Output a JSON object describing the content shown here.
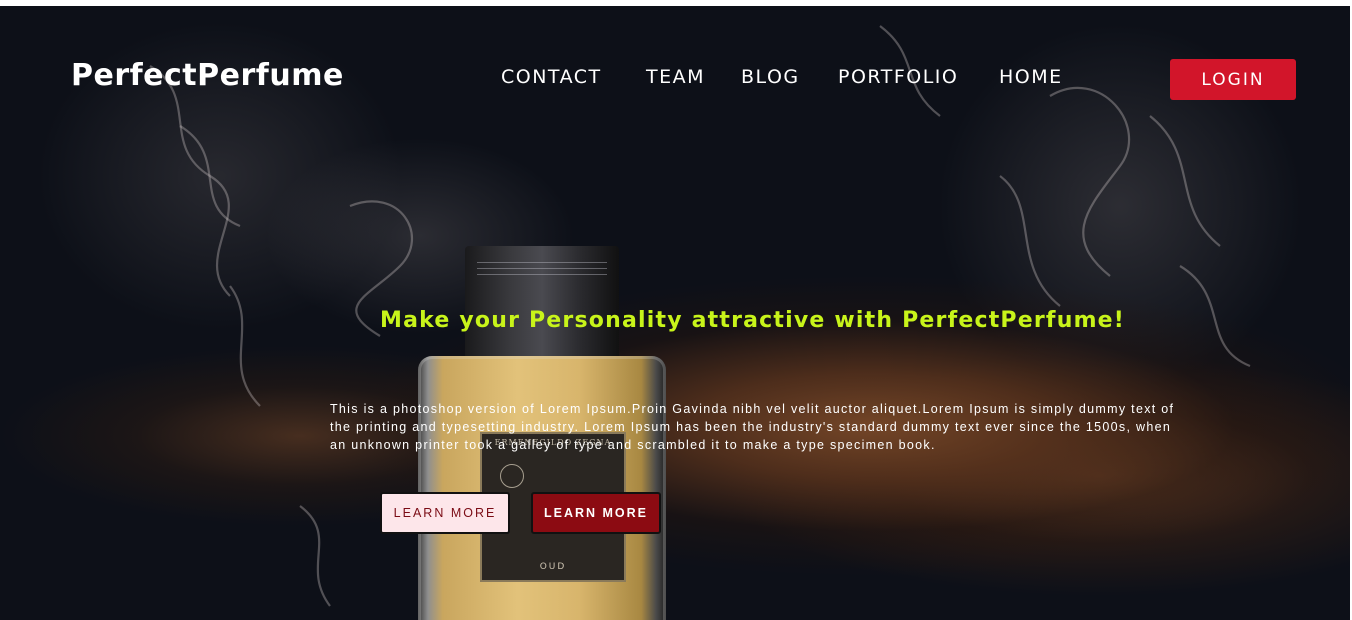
{
  "brand": {
    "name": "PerfectPerfume"
  },
  "nav": {
    "items": [
      {
        "label": "CONTACT"
      },
      {
        "label": "TEAM"
      },
      {
        "label": "BLOG"
      },
      {
        "label": "PORTFOLIO"
      },
      {
        "label": "HOME"
      }
    ],
    "login_label": "LOGIN"
  },
  "hero": {
    "headline": "Make your Personality attractive with PerfectPerfume!",
    "body": "This is a photoshop version of Lorem Ipsum.Proin Gavinda nibh vel velit auctor aliquet.Lorem Ipsum is simply dummy text of the printing and typesetting industry. Lorem Ipsum has been the industry's standard dummy text ever since the 1500s, when an unknown printer took a galley of type and scrambled it to make a type specimen book.",
    "buttons": [
      {
        "label": "LEARN MORE",
        "style": "light"
      },
      {
        "label": "LEARN MORE",
        "style": "dark"
      }
    ],
    "bottle_label": {
      "brand": "ERMENEGILDO ZEGNA",
      "name": "OUD"
    }
  },
  "colors": {
    "background": "#0d1018",
    "accent_headline": "#c8f41a",
    "login_button": "#d2152a",
    "button_dark": "#8c0b12",
    "button_light": "#fde6ea"
  }
}
